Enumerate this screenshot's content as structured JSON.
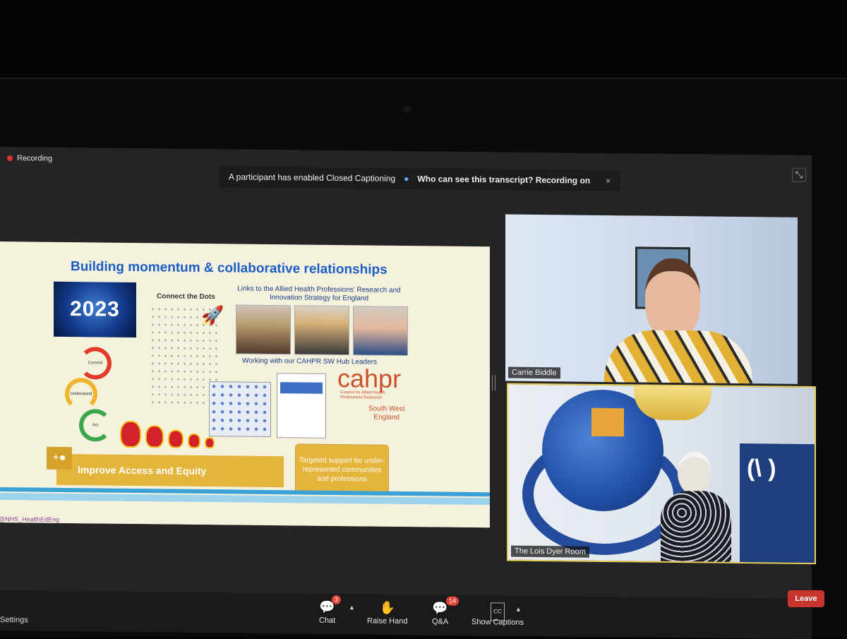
{
  "recording": {
    "label": "Recording"
  },
  "banner": {
    "message": "A participant has enabled Closed Captioning",
    "link_text": "Who can see this transcript? Recording on",
    "close_glyph": "×"
  },
  "exit_fullscreen_glyph": "⤡",
  "slide": {
    "title": "Building momentum & collaborative relationships",
    "year_text": "2023",
    "dots_title": "Connect the Dots",
    "links_text_1": "Links to the Allied Health Professions' Research and",
    "links_text_2": "Innovation Strategy for England",
    "hub_text": "Working with our CAHPR SW Hub Leaders",
    "cycle": [
      "Commit",
      "Understand",
      "Act"
    ],
    "cahpr_logo": "cahpr",
    "cahpr_sub": "Council for Allied Health Professions Research",
    "south_west_1": "South West",
    "south_west_2": "England",
    "access_label": "Improve Access and Equity",
    "targeted_support": "Targeted support for under-represented communities and professions",
    "footer_handle": "@NHS_HealthEdEng"
  },
  "participants": [
    {
      "name": "Carrie Biddle"
    },
    {
      "name": "The Lois Dyer Room"
    }
  ],
  "toolbar": {
    "settings_label": "Settings",
    "chat_label": "Chat",
    "chat_badge": "3",
    "raise_hand_label": "Raise Hand",
    "qa_label": "Q&A",
    "qa_badge": "14",
    "cc_glyph": "CC",
    "captions_label": "Show Captions",
    "leave_label": "Leave"
  },
  "colors": {
    "accent_title": "#1a5cc8",
    "leave_red": "#c8352c",
    "speaker_highlight": "#e7d05a",
    "slide_gold": "#e5b43a"
  }
}
